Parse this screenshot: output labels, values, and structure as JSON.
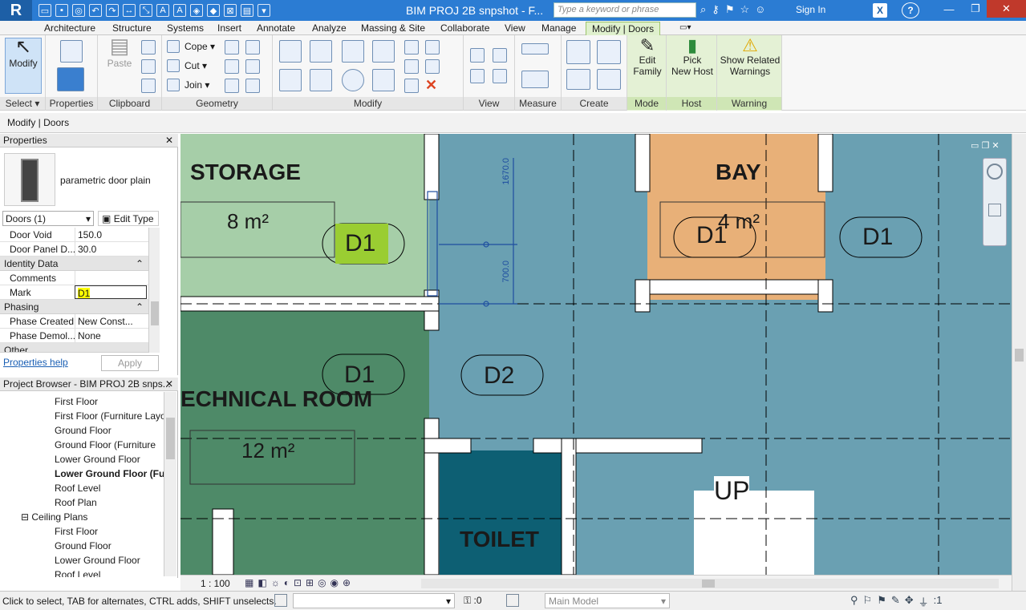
{
  "app": {
    "logo": "R",
    "title": "BIM PROJ 2B snpshot - F...",
    "search_placeholder": "Type a keyword or phrase",
    "sign_in": "Sign In"
  },
  "tabs": [
    "Architecture",
    "Structure",
    "Systems",
    "Insert",
    "Annotate",
    "Analyze",
    "Massing & Site",
    "Collaborate",
    "View",
    "Manage",
    "Modify | Doors"
  ],
  "ribbon": {
    "panels": [
      "Select",
      "Properties",
      "Clipboard",
      "Geometry",
      "Modify",
      "View",
      "Measure",
      "Create",
      "Mode",
      "Host",
      "Warning"
    ],
    "modify": "Modify",
    "paste": "Paste",
    "cope": "Cope",
    "cut": "Cut",
    "join": "Join",
    "edit_family": [
      "Edit",
      "Family"
    ],
    "pick_host": [
      "Pick",
      "New Host"
    ],
    "show_warnings": [
      "Show Related",
      "Warnings"
    ]
  },
  "options_bar": "Modify | Doors",
  "properties": {
    "title": "Properties",
    "type_name": "parametric door plain",
    "selector": "Doors (1)",
    "edit_type": "Edit Type",
    "rows": [
      {
        "k": "Door Void",
        "v": "150.0"
      },
      {
        "k": "Door Panel D...",
        "v": "30.0"
      }
    ],
    "group_identity": "Identity Data",
    "comments": "Comments",
    "mark_label": "Mark",
    "mark_value": "D1",
    "group_phasing": "Phasing",
    "phase_created": {
      "k": "Phase Created",
      "v": "New Const..."
    },
    "phase_demolished": {
      "k": "Phase Demol...",
      "v": "None"
    },
    "group_other": "Other",
    "help": "Properties help",
    "apply": "Apply"
  },
  "browser": {
    "title": "Project Browser - BIM PROJ 2B snps...",
    "items": [
      "First Floor",
      "First Floor (Furniture Layo",
      "Ground  Floor",
      "Ground  Floor  (Furniture",
      "Lower Ground Floor",
      "Lower Ground Floor (Fur",
      "Roof Level",
      "Roof Plan",
      "Ceiling Plans",
      "First Floor",
      "Ground  Floor",
      "Lower Ground Floor",
      "Roof Level"
    ]
  },
  "plan": {
    "rooms": [
      "STORAGE",
      "BAY",
      "ECHNICAL ROOM",
      "TOILET"
    ],
    "areas": [
      "8 m²",
      "4 m²",
      "12 m²"
    ],
    "tags": [
      "D1",
      "D1",
      "D1",
      "D1",
      "D2"
    ],
    "stair": "UP",
    "dims": [
      "1670.0",
      "700.0"
    ],
    "colors": {
      "storage": "#a6cea8",
      "bay": "#e8b078",
      "tech": "#4e8a68",
      "hall": "#6aa0b2",
      "toilet": "#0d5f73"
    }
  },
  "view_bar": {
    "scale": "1 : 100"
  },
  "status": {
    "text": "Click to select, TAB for alternates, CTRL adds, SHIFT unselects.",
    "zero": ":0",
    "model": "Main Model",
    "filter": ":1"
  }
}
